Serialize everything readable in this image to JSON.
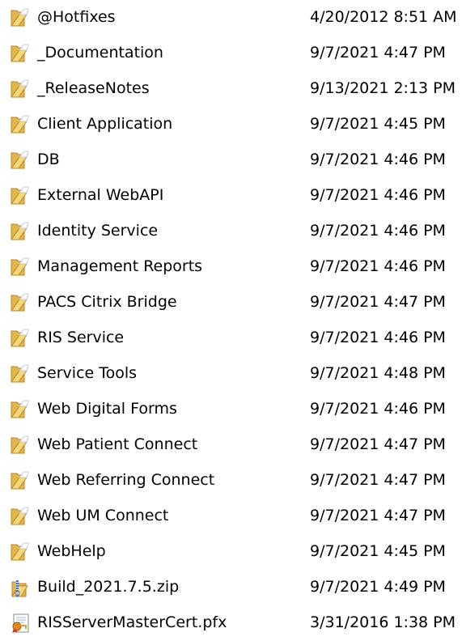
{
  "files": [
    {
      "name": "@Hotfixes",
      "modified": "4/20/2012 8:51 AM",
      "icon": "folder-icon"
    },
    {
      "name": "_Documentation",
      "modified": "9/7/2021 4:47 PM",
      "icon": "folder-icon"
    },
    {
      "name": "_ReleaseNotes",
      "modified": "9/13/2021 2:13 PM",
      "icon": "folder-icon"
    },
    {
      "name": "Client Application",
      "modified": "9/7/2021 4:45 PM",
      "icon": "folder-icon"
    },
    {
      "name": "DB",
      "modified": "9/7/2021 4:46 PM",
      "icon": "folder-icon"
    },
    {
      "name": "External WebAPI",
      "modified": "9/7/2021 4:46 PM",
      "icon": "folder-icon"
    },
    {
      "name": "Identity Service",
      "modified": "9/7/2021 4:46 PM",
      "icon": "folder-icon"
    },
    {
      "name": "Management Reports",
      "modified": "9/7/2021 4:46 PM",
      "icon": "folder-icon"
    },
    {
      "name": "PACS Citrix Bridge",
      "modified": "9/7/2021 4:47 PM",
      "icon": "folder-icon"
    },
    {
      "name": "RIS Service",
      "modified": "9/7/2021 4:46 PM",
      "icon": "folder-icon"
    },
    {
      "name": "Service Tools",
      "modified": "9/7/2021 4:48 PM",
      "icon": "folder-icon"
    },
    {
      "name": "Web Digital Forms",
      "modified": "9/7/2021 4:46 PM",
      "icon": "folder-icon"
    },
    {
      "name": "Web Patient Connect",
      "modified": "9/7/2021 4:47 PM",
      "icon": "folder-icon"
    },
    {
      "name": "Web Referring Connect",
      "modified": "9/7/2021 4:47 PM",
      "icon": "folder-icon"
    },
    {
      "name": "Web UM Connect",
      "modified": "9/7/2021 4:47 PM",
      "icon": "folder-icon"
    },
    {
      "name": "WebHelp",
      "modified": "9/7/2021 4:45 PM",
      "icon": "folder-icon"
    },
    {
      "name": "Build_2021.7.5.zip",
      "modified": "9/7/2021 4:49 PM",
      "icon": "zip-archive-icon"
    },
    {
      "name": "RISServerMasterCert.pfx",
      "modified": "3/31/2016 1:38 PM",
      "icon": "certificate-icon"
    }
  ],
  "colors": {
    "background": "#ffffff",
    "text": "#000000",
    "folder_back": "#e3b64a",
    "folder_front": "#f6d77c",
    "folder_edge": "#b8862a",
    "zip_body": "#f6d77c",
    "zip_zipper": "#3a6ec8",
    "cert_paper": "#ffffff",
    "cert_seal": "#e08a1e"
  }
}
